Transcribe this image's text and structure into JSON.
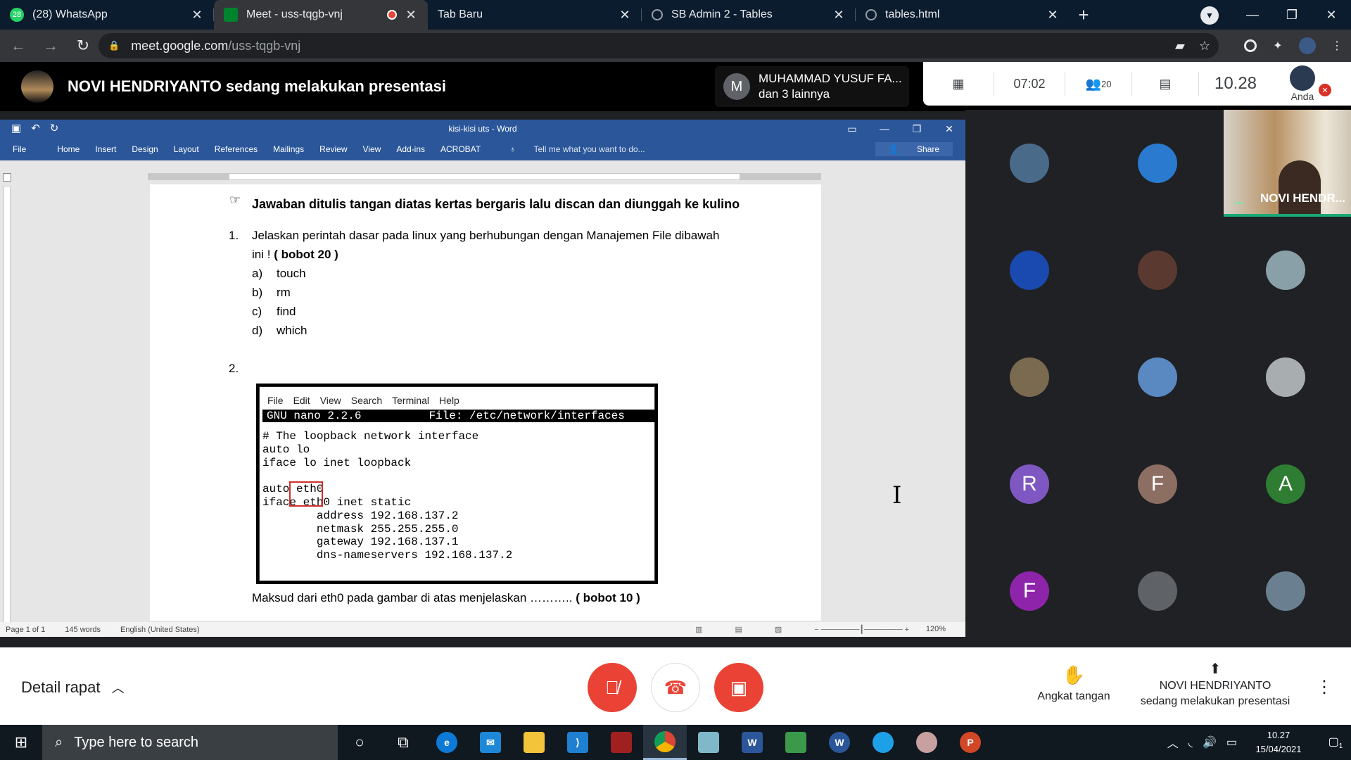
{
  "browser": {
    "tabs": [
      {
        "title": "(28) WhatsApp",
        "icon": "whatsapp-icon",
        "badge": "28"
      },
      {
        "title": "Meet - uss-tqgb-vnj",
        "icon": "meet-icon",
        "recording": true
      },
      {
        "title": "Tab Baru",
        "icon": ""
      },
      {
        "title": "SB Admin 2 - Tables",
        "icon": "globe-icon"
      },
      {
        "title": "tables.html",
        "icon": "globe-icon"
      }
    ],
    "url_host": "meet.google.com",
    "url_path": "/uss-tqgb-vnj"
  },
  "meet": {
    "presenter_banner": "NOVI HENDRIYANTO sedang melakukan presentasi",
    "speaking_initial": "M",
    "speaking_name": "MUHAMMAD YUSUF FA...",
    "speaking_others": "dan 3 lainnya",
    "call_time": "07:02",
    "participant_count": "20",
    "clock": "10.28",
    "self_label": "Anda",
    "self_tile_name": "NOVI HENDR...",
    "details_label": "Detail rapat",
    "raise_hand": "Angkat tangan",
    "presenting_name": "NOVI HENDRIYANTO",
    "presenting_text": "sedang melakukan presentasi",
    "participants": [
      {
        "initial": "",
        "color": "#4a6a8a"
      },
      {
        "initial": "",
        "color": "#2a7ad0"
      },
      {
        "initial": "",
        "color": "#1a4ab0"
      },
      {
        "initial": "",
        "color": "#5a3a30"
      },
      {
        "initial": "",
        "color": "#8aa0a8"
      },
      {
        "initial": "",
        "color": "#7a6a50"
      },
      {
        "initial": "",
        "color": "#5a88c0"
      },
      {
        "initial": "",
        "color": "#a8aeb0"
      },
      {
        "initial": "R",
        "color": "#7e57c2"
      },
      {
        "initial": "F",
        "color": "#8d6e63"
      },
      {
        "initial": "A",
        "color": "#2e7d32"
      },
      {
        "initial": "F",
        "color": "#8e24aa"
      },
      {
        "initial": "",
        "color": "#5f6368"
      },
      {
        "initial": "",
        "color": "#6a8090"
      }
    ]
  },
  "word": {
    "title": "kisi-kisi uts - Word",
    "menu": [
      "File",
      "Home",
      "Insert",
      "Design",
      "Layout",
      "References",
      "Mailings",
      "Review",
      "View",
      "Add-ins",
      "ACROBAT"
    ],
    "tell_me": "Tell me what you want to do...",
    "share": "Share",
    "heading": "Jawaban ditulis tangan diatas kertas bergaris lalu discan dan diunggah ke kulino",
    "q1_num": "1.",
    "q1_text": "Jelaskan perintah dasar pada linux yang berhubungan dengan Manajemen File dibawah",
    "q1_text2": "ini !",
    "q1_weight": "( bobot 20 )",
    "q1_items": [
      {
        "letter": "a)",
        "text": "touch"
      },
      {
        "letter": "b)",
        "text": "rm"
      },
      {
        "letter": "c)",
        "text": "find"
      },
      {
        "letter": "d)",
        "text": "which"
      }
    ],
    "q2_num": "2.",
    "terminal_menu": [
      "File",
      "Edit",
      "View",
      "Search",
      "Terminal",
      "Help"
    ],
    "nano_bar": "GNU nano 2.2.6          File: /etc/network/interfaces",
    "nano_lines": "# The loopback network interface\nauto lo\niface lo inet loopback\n\nauto eth0\niface eth0 inet static\n        address 192.168.137.2\n        netmask 255.255.255.0\n        gateway 192.168.137.1\n        dns-nameservers 192.168.137.2",
    "q2_text": "Maksud dari eth0 pada gambar di atas menjelaskan ………..",
    "q2_weight": "( bobot 10 )",
    "status_page": "Page 1 of 1",
    "status_words": "145 words",
    "status_lang": "English (United States)",
    "zoom": "120%"
  },
  "taskbar": {
    "search_placeholder": "Type here to search",
    "time": "10.27",
    "date": "15/04/2021",
    "notif_count": "1"
  }
}
